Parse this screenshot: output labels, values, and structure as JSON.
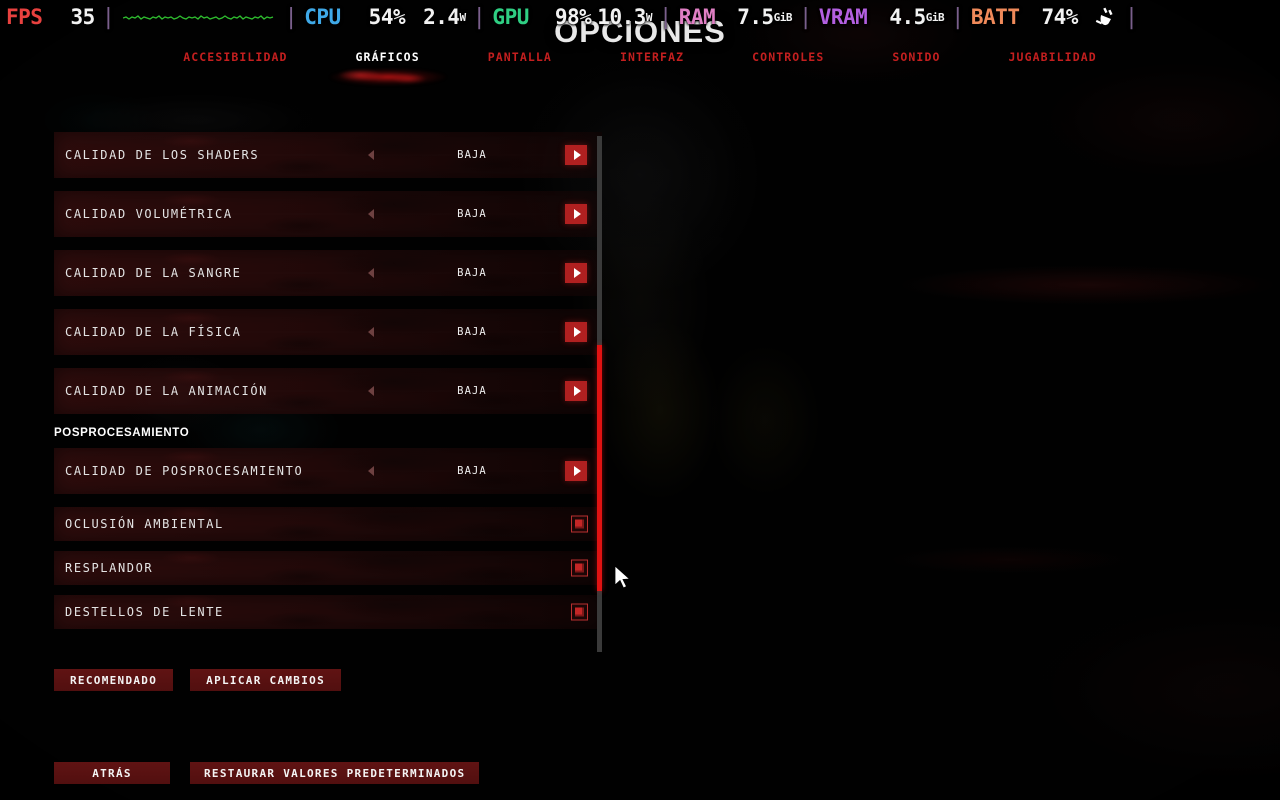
{
  "overlay": {
    "fps_label": "FPS",
    "fps_value": "35",
    "cpu_label": "CPU",
    "cpu_percent": "54%",
    "cpu_watts": "2.4",
    "cpu_watts_unit": "W",
    "gpu_label": "GPU",
    "gpu_percent": "98%",
    "gpu_watts": "10.3",
    "gpu_watts_unit": "W",
    "ram_label": "RAM",
    "ram_value": "7.5",
    "ram_unit": "GiB",
    "vram_label": "VRAM",
    "vram_value": "4.5",
    "vram_unit": "GiB",
    "batt_label": "BATT",
    "batt_value": "74%",
    "plug_icon": "power-plug-icon",
    "separator": "|",
    "colors": {
      "fps": "#e8413f",
      "cpu": "#3fa9e8",
      "gpu": "#2fcf83",
      "ram": "#e07fc4",
      "vram": "#b35fe0",
      "batt": "#f08a5a",
      "graph_line": "#2fbf2f",
      "separator": "#7a5f8c"
    },
    "fps_graph": "fps-sparkline"
  },
  "header": {
    "title": "OPCIONES"
  },
  "tabs": [
    {
      "label": "ACCESIBILIDAD",
      "active": false
    },
    {
      "label": "GRÁFICOS",
      "active": true
    },
    {
      "label": "PANTALLA",
      "active": false
    },
    {
      "label": "INTERFAZ",
      "active": false
    },
    {
      "label": "CONTROLES",
      "active": false
    },
    {
      "label": "SONIDO",
      "active": false
    },
    {
      "label": "JUGABILIDAD",
      "active": false
    }
  ],
  "settings": {
    "stepper_rows": [
      {
        "label": "CALIDAD DE LOS SHADERS",
        "value": "BAJA"
      },
      {
        "label": "CALIDAD VOLUMÉTRICA",
        "value": "BAJA"
      },
      {
        "label": "CALIDAD DE LA SANGRE",
        "value": "BAJA"
      },
      {
        "label": "CALIDAD DE LA FÍSICA",
        "value": "BAJA"
      },
      {
        "label": "CALIDAD DE LA ANIMACIÓN",
        "value": "BAJA"
      }
    ],
    "section_title": "POSPROCESAMIENTO",
    "post_stepper_rows": [
      {
        "label": "CALIDAD DE POSPROCESAMIENTO",
        "value": "BAJA"
      }
    ],
    "toggle_rows": [
      {
        "label": "OCLUSIÓN AMBIENTAL",
        "checked": true
      },
      {
        "label": "RESPLANDOR",
        "checked": true
      },
      {
        "label": "DESTELLOS DE LENTE",
        "checked": true
      }
    ]
  },
  "actions": {
    "recommended": "RECOMENDADO",
    "apply": "APLICAR CAMBIOS"
  },
  "footer": {
    "back": "ATRÁS",
    "restore_defaults": "RESTAURAR VALORES PREDETERMINADOS"
  },
  "scrollbar": {
    "name": "vertical-scrollbar"
  },
  "cursor": {
    "name": "mouse-pointer"
  },
  "accent_colors": {
    "red": "#c41f1f",
    "bright_red": "#e01212",
    "button_bg": "#651414",
    "arrow_box": "#b02020"
  }
}
